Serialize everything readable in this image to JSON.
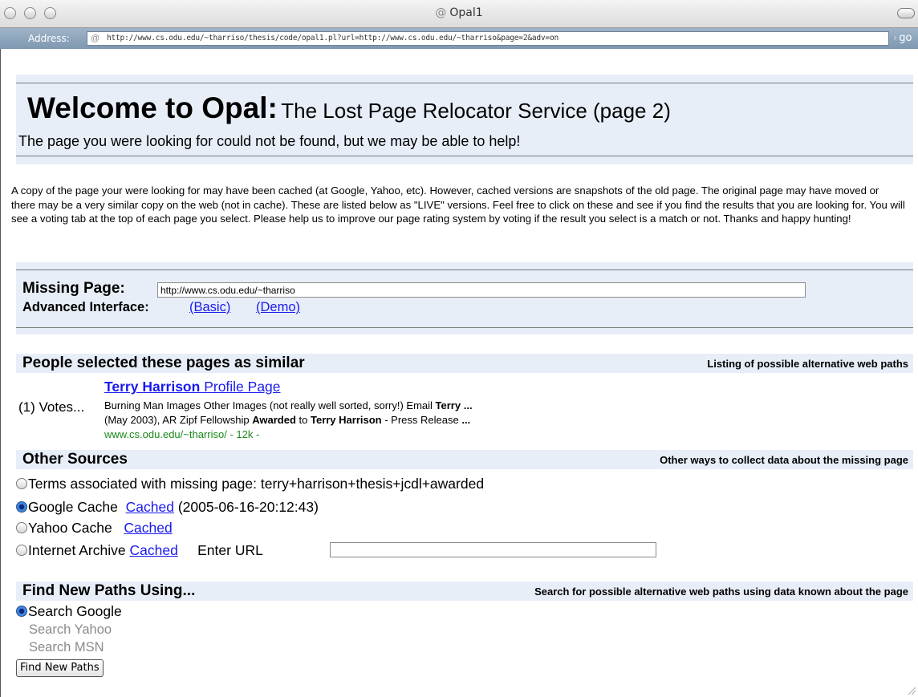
{
  "window": {
    "title": "Opal1",
    "title_icon": "@",
    "address_label": "Address:",
    "address_icon": "@",
    "url": "http://www.cs.odu.edu/~tharriso/thesis/code/opal1.pl?url=http://www.cs.odu.edu/~tharriso&page=2&adv=on",
    "go_label": "go"
  },
  "header": {
    "title_bold": "Welcome to Opal:",
    "title_rest": "The Lost Page Relocator Service (page 2)",
    "subtitle": "The page you were looking for could not be found, but we may be able to help!"
  },
  "intro": "A copy of the page your were looking for may have been cached (at Google, Yahoo, etc). However, cached versions are snapshots of the old page. The original page may have moved or there may be a very similar copy on the web (not in cache). These are listed below as \"LIVE\" versions. Feel free to click on these and see if you find the results that you are looking for. You will see a voting tab at the top of each page you select. Please help us to improve our page rating system by voting if the result you select is a match or not. Thanks and happy hunting!",
  "missing": {
    "label": "Missing Page:",
    "value": "http://www.cs.odu.edu/~tharriso",
    "advanced_label": "Advanced Interface:",
    "basic_link": "(Basic)",
    "demo_link": "(Demo)"
  },
  "similar": {
    "title": "People selected these pages as similar",
    "right": "Listing of possible alternative web paths",
    "votes": "(1) Votes...",
    "result_title_bold": "Terry Harrison",
    "result_title_rest": "Profile Page",
    "snippet1_a": "Burning Man Images Other Images (not really well sorted, sorry!) Email ",
    "snippet1_b": "Terry",
    "snippet1_c": " ...",
    "snippet2_a": "(May 2003), AR Zipf Fellowship ",
    "snippet2_b": "Awarded",
    "snippet2_c": " to ",
    "snippet2_d": "Terry Harrison",
    "snippet2_e": " - Press Release ",
    "snippet2_f": "...",
    "result_url": "www.cs.odu.edu/~tharriso/ - 12k -"
  },
  "other": {
    "title": "Other Sources",
    "right": "Other ways to collect data about the missing page",
    "terms": "Terms associated with missing page: terry+harrison+thesis+jcdl+awarded",
    "google_label": "Google Cache",
    "google_link": "Cached",
    "google_date": "(2005-06-16-20:12:43)",
    "yahoo_label": "Yahoo Cache",
    "yahoo_link": "Cached",
    "archive_label": "Internet Archive",
    "archive_link": "Cached",
    "enter_url_label": "Enter URL",
    "selected": "Google Cache"
  },
  "find": {
    "title": "Find New Paths Using...",
    "right": "Search for possible alternative web paths using data known about the page",
    "opt_google": "Search Google",
    "opt_yahoo": "Search Yahoo",
    "opt_msn": "Search MSN",
    "button": "Find New Paths"
  }
}
